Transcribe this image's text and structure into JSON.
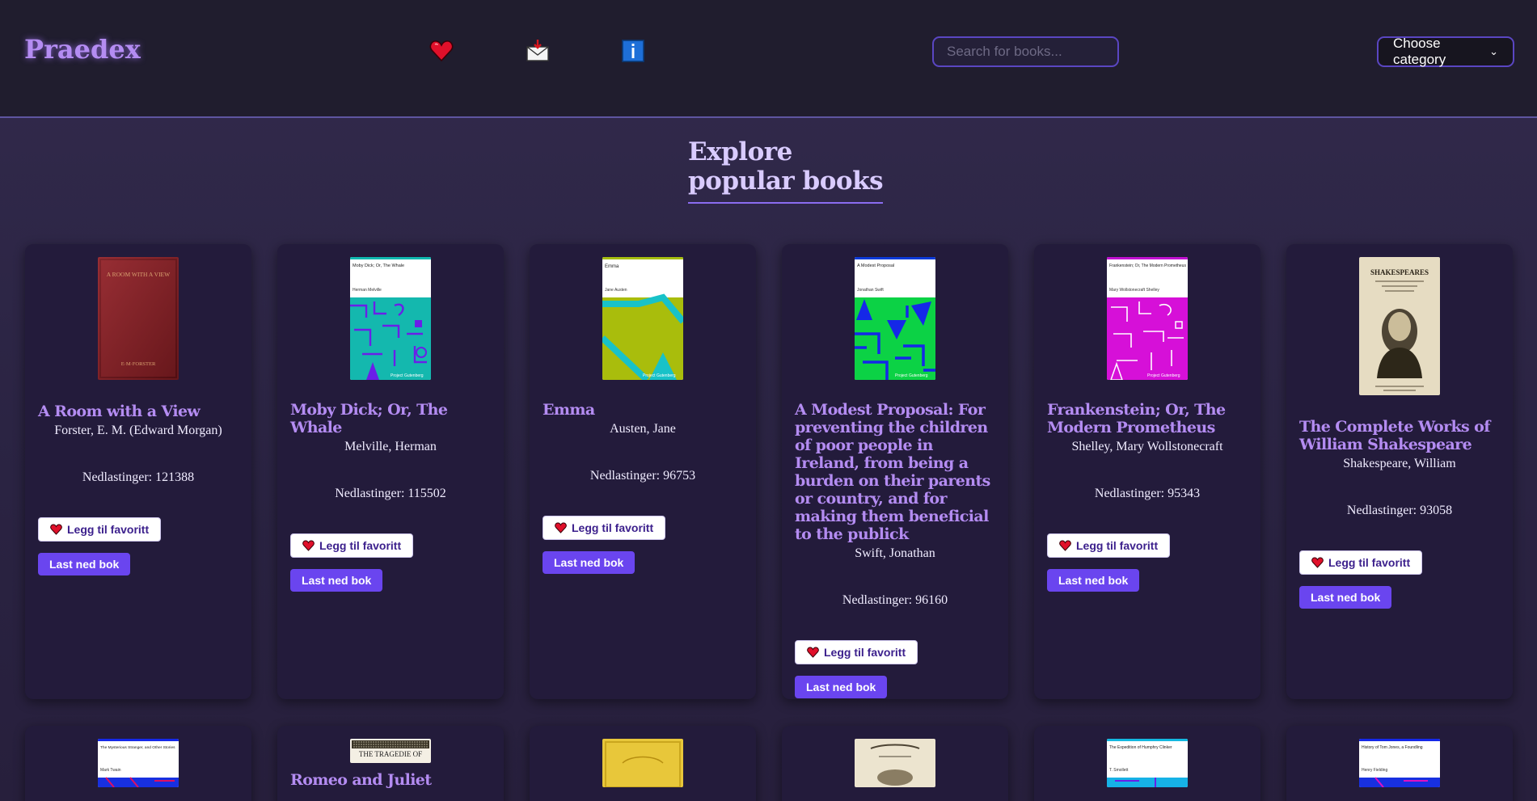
{
  "header": {
    "logo": "Praedex",
    "nav_icons": [
      "heart-icon",
      "inbox-download-icon",
      "info-icon"
    ],
    "search_placeholder": "Search for books...",
    "category_label": "Choose category"
  },
  "section": {
    "title_line1": "Explore",
    "title_line2": "popular books"
  },
  "labels": {
    "favorite": "Legg til favoritt",
    "download": "Last ned bok"
  },
  "books": [
    {
      "title": "A Room with a View",
      "author": "Forster, E. M. (Edward Morgan)",
      "downloads": "Nedlastinger: 121388",
      "cover_title": "A ROOM WITH A VIEW",
      "cover_author": "E·M·FORSTER"
    },
    {
      "title": "Moby Dick; Or, The Whale",
      "author": "Melville, Herman",
      "downloads": "Nedlastinger: 115502",
      "cover_title": "Moby Dick; Or, The Whale",
      "cover_author": "Herman Melville",
      "cover_publisher": "Project Gutenberg"
    },
    {
      "title": "Emma",
      "author": "Austen, Jane",
      "downloads": "Nedlastinger: 96753",
      "cover_title": "Emma",
      "cover_author": "Jane Austen",
      "cover_publisher": "Project Gutenberg"
    },
    {
      "title": "A Modest Proposal: For preventing the children of poor people in Ireland, from being a burden on their parents or country, and for making them beneficial to the publick",
      "author": "Swift, Jonathan",
      "downloads": "Nedlastinger: 96160",
      "cover_title": "A Modest Proposal",
      "cover_author": "Jonathan Swift",
      "cover_publisher": "Project Gutenberg"
    },
    {
      "title": "Frankenstein; Or, The Modern Prometheus",
      "author": "Shelley, Mary Wollstonecraft",
      "downloads": "Nedlastinger: 95343",
      "cover_title": "Frankenstein; Or, The Modern Prometheus",
      "cover_author": "Mary Wollstonecraft Shelley",
      "cover_publisher": "Project Gutenberg"
    },
    {
      "title": "The Complete Works of William Shakespeare",
      "author": "Shakespeare, William",
      "downloads": "Nedlastinger: 93058",
      "cover_title": "SHAKESPEARES"
    }
  ],
  "books_row2": [
    {
      "title": "",
      "cover_title": "The Mysterious Stranger, and Other Stories",
      "cover_author": "Mark Twain"
    },
    {
      "title": "Romeo and Juliet",
      "cover_title": "THE TRAGEDIE OF"
    },
    {
      "title": ""
    },
    {
      "title": ""
    },
    {
      "title": "",
      "cover_title": "The Expedition of Humphry Clinker",
      "cover_author": "T. Smollett"
    },
    {
      "title": "",
      "cover_title": "History of Tom Jones, a Foundling",
      "cover_author": "Henry Fielding"
    }
  ],
  "colors": {
    "accent": "#6a45ef",
    "title": "#b48cf2",
    "card_bg": "#231b3b",
    "page_bg": "#2d2644",
    "header_bg": "#201d2e"
  }
}
